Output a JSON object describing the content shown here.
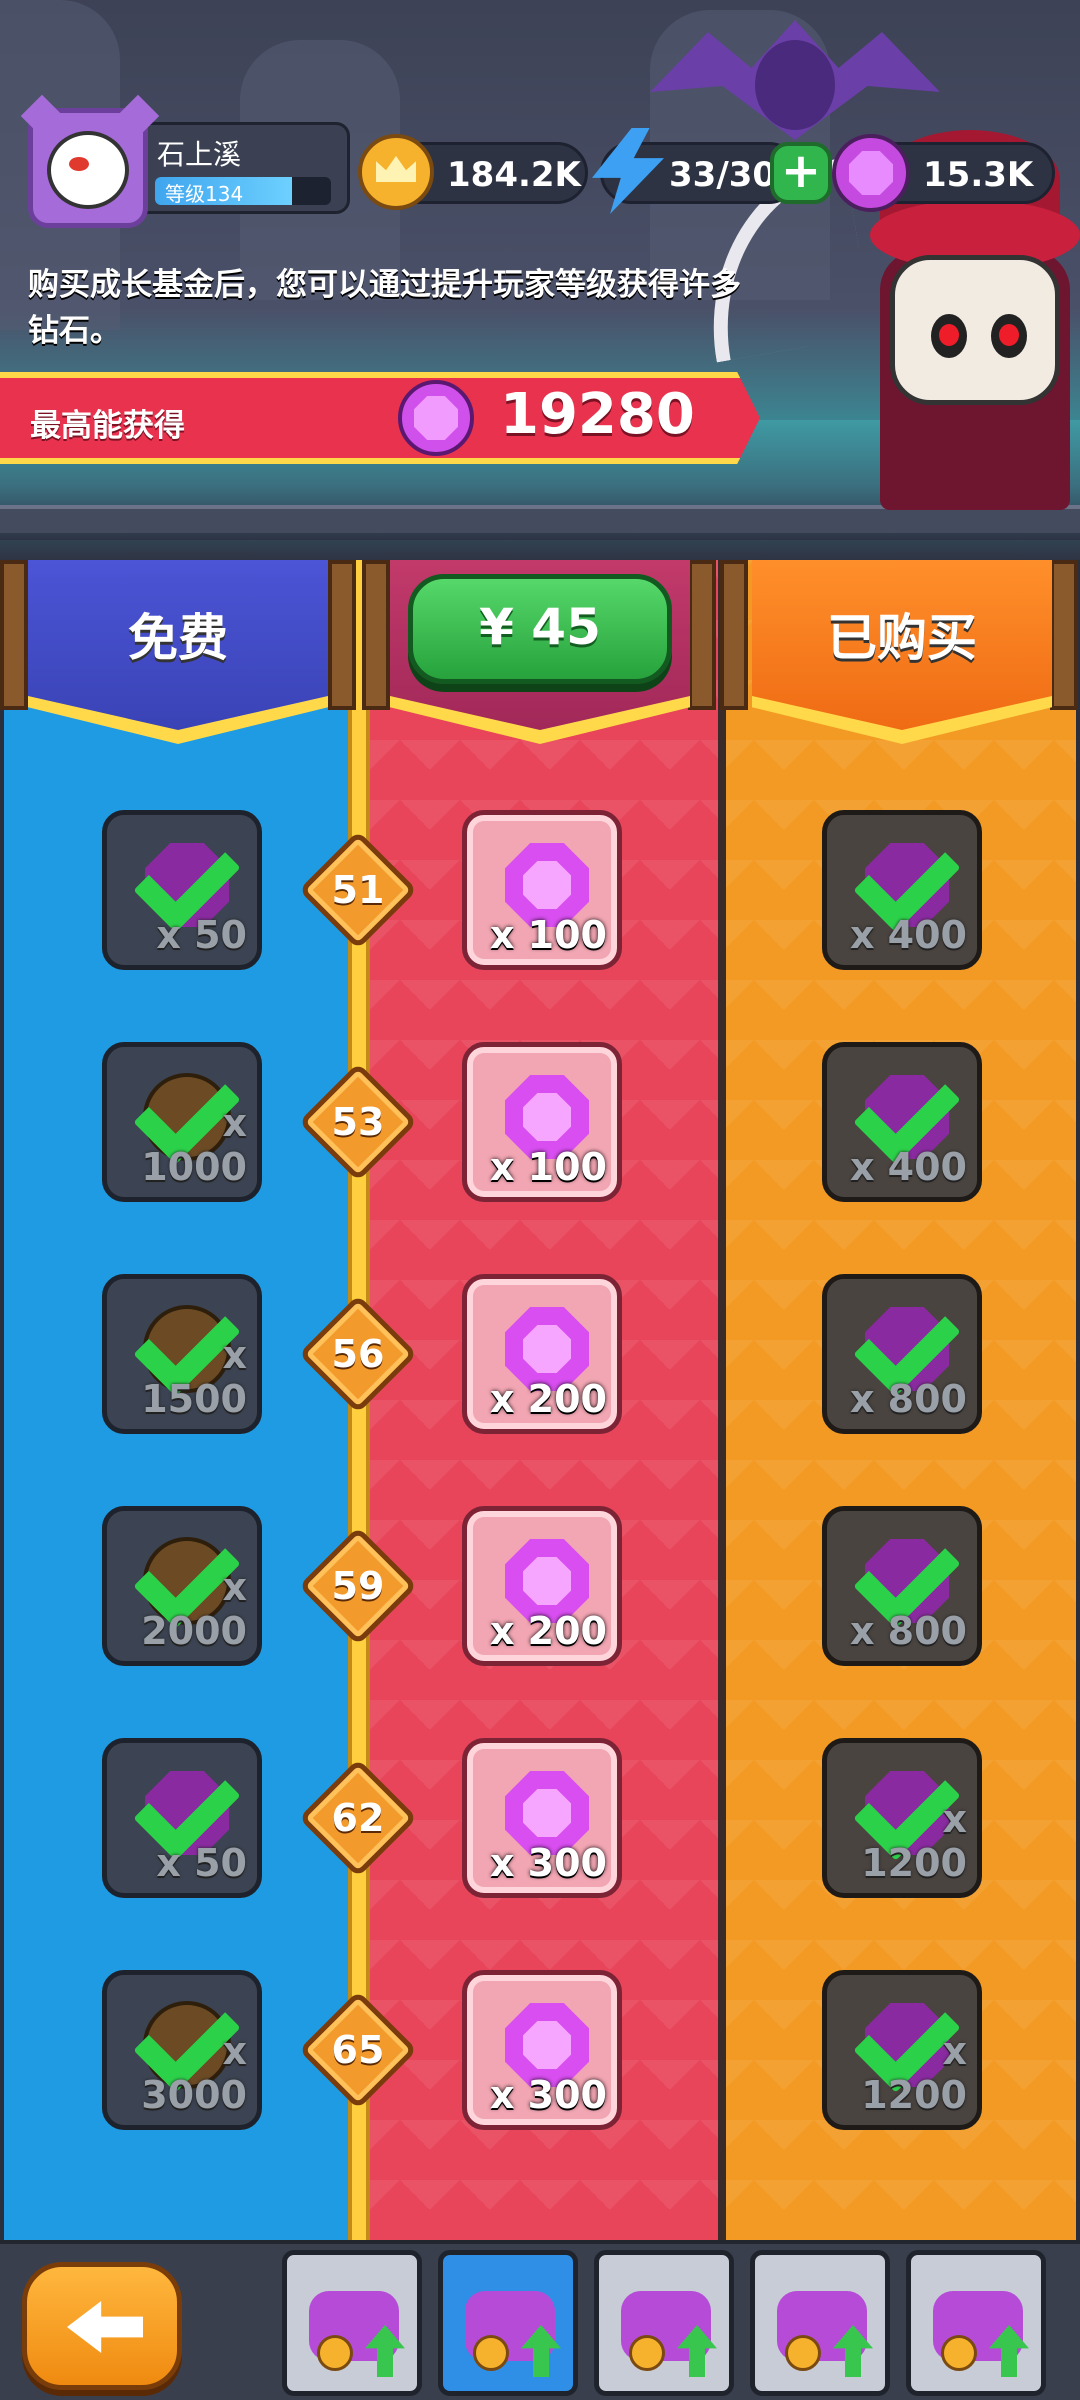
{
  "player": {
    "name": "石上溪",
    "level_text": "等级134",
    "level_progress": 0.78
  },
  "resources": {
    "coins": "184.2K",
    "energy": "33/30",
    "gems": "15.3K"
  },
  "description": "购买成长基金后，您可以通过提升玩家等级获得许多钻石。",
  "banner": {
    "label": "最高能获得",
    "value": "19280"
  },
  "columns": {
    "free_label": "免费",
    "price_label": "¥ 45",
    "bought_label": "已购买"
  },
  "rows": [
    {
      "level": "51",
      "free": {
        "icon": "gem-icon",
        "qty": "x 50",
        "claimed": true
      },
      "paid": {
        "icon": "gem-icon",
        "qty": "x 100"
      },
      "bought": {
        "icon": "gem-icon",
        "qty": "x 400",
        "claimed": true
      }
    },
    {
      "level": "53",
      "free": {
        "icon": "coin-icon",
        "qty": "x 1000",
        "claimed": true
      },
      "paid": {
        "icon": "gem-icon",
        "qty": "x 100"
      },
      "bought": {
        "icon": "gem-icon",
        "qty": "x 400",
        "claimed": true
      }
    },
    {
      "level": "56",
      "free": {
        "icon": "coin-icon",
        "qty": "x 1500",
        "claimed": true
      },
      "paid": {
        "icon": "gem-icon",
        "qty": "x 200"
      },
      "bought": {
        "icon": "gem-icon",
        "qty": "x 800",
        "claimed": true
      }
    },
    {
      "level": "59",
      "free": {
        "icon": "coin-icon",
        "qty": "x 2000",
        "claimed": true
      },
      "paid": {
        "icon": "gem-icon",
        "qty": "x 200"
      },
      "bought": {
        "icon": "gem-icon",
        "qty": "x 800",
        "claimed": true
      }
    },
    {
      "level": "62",
      "free": {
        "icon": "gem-icon",
        "qty": "x 50",
        "claimed": true
      },
      "paid": {
        "icon": "gem-icon",
        "qty": "x 300"
      },
      "bought": {
        "icon": "gem-icon",
        "qty": "x 1200",
        "claimed": true
      }
    },
    {
      "level": "65",
      "free": {
        "icon": "coin-icon",
        "qty": "x 3000",
        "claimed": true
      },
      "paid": {
        "icon": "gem-icon",
        "qty": "x 300"
      },
      "bought": {
        "icon": "gem-icon",
        "qty": "x 1200",
        "claimed": true
      }
    }
  ],
  "nav": {
    "tabs": [
      {
        "icon": "bat-upgrade-icon",
        "active": false
      },
      {
        "icon": "witch-hat-coins-icon",
        "active": true
      },
      {
        "icon": "cart-upgrade-icon",
        "active": false
      },
      {
        "icon": "treasure-pot-icon",
        "active": false
      },
      {
        "icon": "gift-box-coins-icon",
        "active": false
      }
    ]
  },
  "colors": {
    "free_column": "#1e9be3",
    "paid_column": "#e8455a",
    "bought_column": "#f39a24",
    "price_button": "#27a23c",
    "check": "#2bd149"
  }
}
